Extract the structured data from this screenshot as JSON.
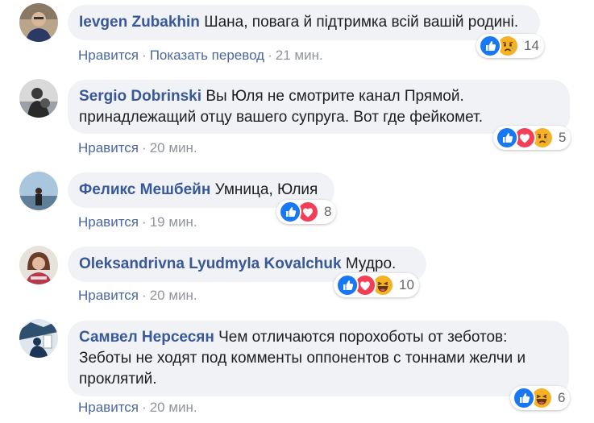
{
  "comments": [
    {
      "author": "Ievgen Zubakhin",
      "text": "Шана, повага й підтримка всій вашій родині.",
      "like": "Нравится",
      "translate": "Показать перевод",
      "time": "21 мин.",
      "reaction_count": "14",
      "reactions": [
        "like",
        "sad"
      ]
    },
    {
      "author": "Sergio Dobrinski",
      "text": "Вы Юля не смотрите канал Прямой. принадлежащий отцу вашего супруга. Вот где фейкомет.",
      "like": "Нравится",
      "time": "20 мин.",
      "reaction_count": "5",
      "reactions": [
        "like",
        "love",
        "sad"
      ]
    },
    {
      "author": "Феликс Мешбейн",
      "text": "Умница, Юлия",
      "like": "Нравится",
      "time": "19 мин.",
      "reaction_count": "8",
      "reactions": [
        "like",
        "love"
      ]
    },
    {
      "author": "Oleksandrivna Lyudmyla Kovalchuk",
      "text": "Мудро.",
      "like": "Нравится",
      "time": "20 мин.",
      "reaction_count": "10",
      "reactions": [
        "like",
        "love",
        "haha"
      ]
    },
    {
      "author": "Самвел Нерсесян",
      "text": "Чем отличаются порохоботы от зеботов: Зеботы не ходят под комменты оппонентов с тоннами желчи и проклятий.",
      "like": "Нравится",
      "time": "20 мин.",
      "reaction_count": "6",
      "reactions": [
        "like",
        "haha"
      ]
    }
  ],
  "colors": {
    "author": "#385898",
    "bubble": "#f0f2f5",
    "like": "#1877f2",
    "love": "#f33e58",
    "sad_haha": "#f7b125"
  }
}
